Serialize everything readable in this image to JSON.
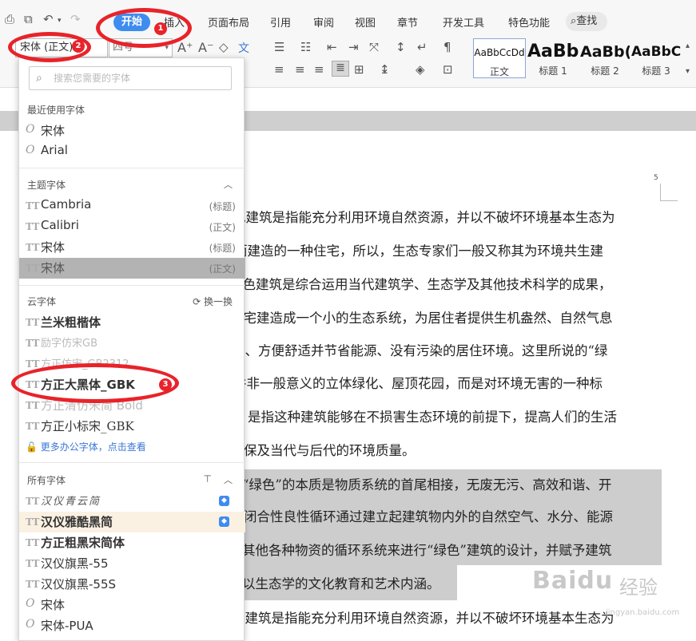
{
  "ribbon": {
    "tabs": [
      "开始",
      "插入",
      "页面布局",
      "引用",
      "审阅",
      "视图",
      "章节",
      "开发工具",
      "特色功能"
    ],
    "search_label": "查找"
  },
  "toolbar": {
    "font_name": "宋体 (正文)",
    "font_size": "四号",
    "styles": [
      {
        "preview": "AaBbCcDd",
        "label": "正文"
      },
      {
        "preview": "AaBb",
        "label": "标题 1"
      },
      {
        "preview": "AaBb(",
        "label": "标题 2"
      },
      {
        "preview": "AaBbC",
        "label": "标题 3"
      }
    ]
  },
  "font_dropdown": {
    "search_placeholder": "搜索您需要的字体",
    "recent": {
      "title": "最近使用字体",
      "items": [
        "宋体",
        "Arial"
      ]
    },
    "theme": {
      "title": "主题字体",
      "items": [
        {
          "name": "Cambria",
          "tag": "(标题)"
        },
        {
          "name": "Calibri",
          "tag": "(正文)"
        },
        {
          "name": "宋体",
          "tag": "(标题)"
        },
        {
          "name": "宋体",
          "tag": "(正文)"
        }
      ]
    },
    "cloud": {
      "title": "云字体",
      "refresh_label": "换一换",
      "items": [
        "兰米粗楷体",
        "励字仿宋GB",
        "方正仿宋_GB2312",
        "方正大黑体_GBK",
        "方正清仿宋简 Bold",
        "方正小标宋_GBK"
      ],
      "more_link": "更多办公字体，点击查看"
    },
    "all": {
      "title": "所有字体",
      "items": [
        "汉仪青云简",
        "汉仪雅酷黑简",
        "方正粗黑宋简体",
        "汉仪旗黑-55",
        "汉仪旗黑-55S",
        "宋体",
        "宋体-PUA"
      ]
    }
  },
  "document": {
    "page_number": "5",
    "lines": [
      "色建筑是指能充分利用环境自然资源，并以不破坏环境基本生态为",
      "而建造的一种住宅，所以，生态专家们一般又称其为环境共生建",
      "绿色建筑是综合运用当代建筑学、生态学及其他技术科学的成果，",
      "住宅建造成一个小的生态系统，为居住者提供生机盎然、自然气息",
      "宜、方便舒适并节省能源、没有污染的居住环境。这里所说的“绿",
      "并非一般意义的立体绿化、屋顶花园，而是对环境无害的一种标",
      "是指这种建筑能够在不损害生态环境的前提下，提高人们的生活",
      "保及当代与后代的环境质量。",
      "“绿色”的本质是物质系统的首尾相接，无废无污、高效和谐、开",
      "闭合性良性循环通过建立起建筑物内外的自然空气、水分、能源",
      "其他各种物资的循环系统来进行“绿色”建筑的设计，并赋予建筑",
      "以生态学的文化教育和艺术内涵。",
      "色建筑是指能充分利用环境自然资源，并以不破坏环境基本生态为"
    ]
  },
  "watermark": {
    "brand": "Baidu",
    "sub": "经验",
    "url": "jingyan.baidu.com"
  },
  "annotations": [
    "1",
    "2",
    "3"
  ]
}
